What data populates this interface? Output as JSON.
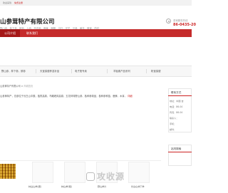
{
  "topbar": {
    "link_1": "欢迎来到",
    "link_2": "免费注册"
  },
  "header": {
    "company": "山参茸特产有限公司",
    "subtitle": "野山参、林下参、鲜参、人参、西洋参、鹿茸、鹿鞭、当归、灵芝、贝母、黄芪、蜂蜜、药材",
    "phone_label": "咨询服务热线",
    "phone": "86-0435-20"
  },
  "nav": {
    "items": [
      "公司介绍",
      "联系我们"
    ]
  },
  "categories": [
    "野山参、林下参、鲜参",
    "天宝保健养滋补品",
    "电子煲专卖",
    "羊胎素产品系列",
    "粉宝保健"
  ],
  "breadcrumb": {
    "home": "山参茸特产有限公司",
    "sep": ">",
    "current": "商城首页"
  },
  "intro": {
    "text": "山参茸特产，总部位于长白山中麓，独揽高原，鸟瞰峰岚高原，五花林特野山参、各种参制品，各种参种苗、鹿茸、木耳、",
    "more": "详细"
  },
  "sidebar": {
    "contact_title": "联系方式",
    "contact_lines": [
      "地址：中国 吉",
      "电话：86-04",
      "传真：86-04",
      "联系人：",
      "手机：",
      "邮件："
    ],
    "search_title": "站内搜索"
  },
  "products": [
    {
      "caption": ""
    },
    {
      "caption": "林业山参(细)"
    },
    {
      "caption": "林山参(粗)"
    },
    {
      "caption": "野山参片"
    },
    {
      "caption": "长白山林下参"
    }
  ],
  "watermark": {
    "text": "攻收源"
  }
}
